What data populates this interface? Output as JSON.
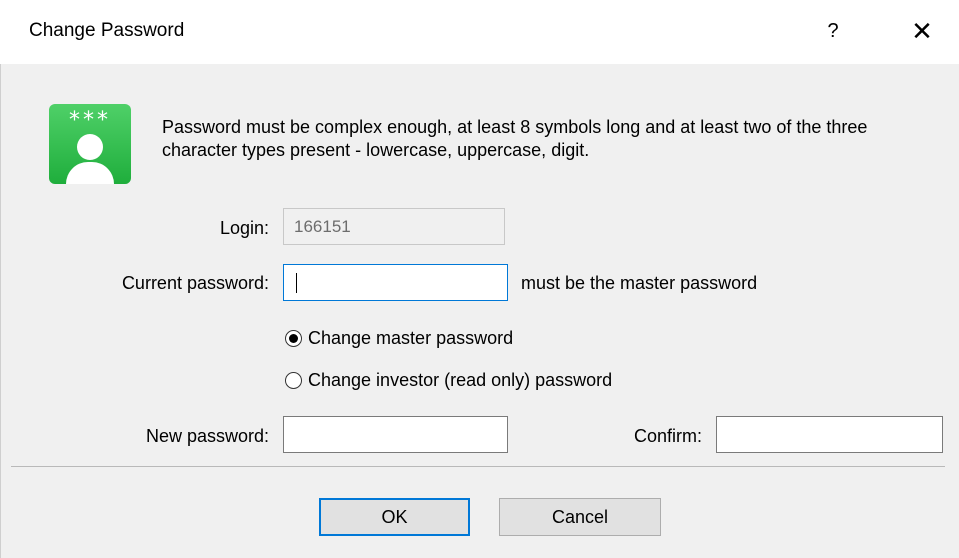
{
  "window": {
    "title": "Change Password",
    "help_label": "?",
    "close_label": "✕"
  },
  "icon": {
    "name": "password-user-icon",
    "stars": "***",
    "color": "#22b040"
  },
  "info": {
    "text": "Password must be complex enough, at least 8 symbols long and at least two of the three character types present - lowercase, uppercase, digit."
  },
  "form": {
    "login": {
      "label": "Login:",
      "value": "166151"
    },
    "current_password": {
      "label": "Current password:",
      "value": "",
      "hint": "must be the master password"
    },
    "radio_options": [
      {
        "label": "Change master password",
        "checked": true
      },
      {
        "label": "Change investor (read only) password",
        "checked": false
      }
    ],
    "new_password": {
      "label": "New password:",
      "value": ""
    },
    "confirm": {
      "label": "Confirm:",
      "value": ""
    }
  },
  "buttons": {
    "ok_label": "OK",
    "cancel_label": "Cancel"
  },
  "colors": {
    "focus_accent": "#0078d7"
  }
}
